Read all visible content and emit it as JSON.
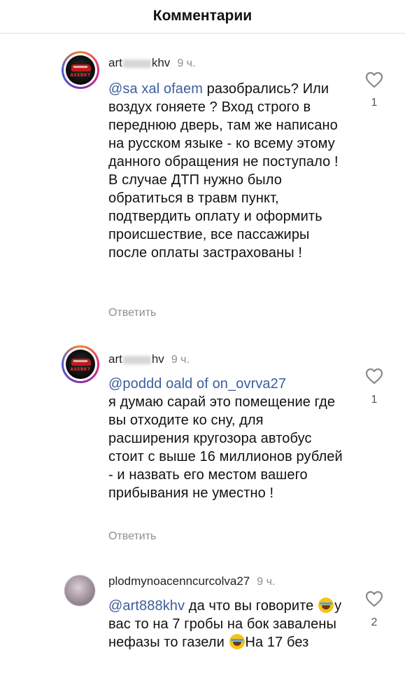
{
  "header": {
    "title": "Комментарии"
  },
  "comments": [
    {
      "username_start": "art",
      "username_end": "khv",
      "time": "9 ч.",
      "mention": "@sa  xal ofaem",
      "text": " разобрались? Или воздух гоняете ? Вход строго в переднюю дверь, там же написано на русском языке - ко всему этому данного обращения не поступало ! В случае ДТП нужно было обратиться в травм пункт, подтвердить оплату и оформить происшествие, все пассажиры после оплаты застрахованы !",
      "reply_label": "Ответить",
      "likes": "1"
    },
    {
      "username_start": "art",
      "username_end": "hv",
      "time": "9 ч.",
      "mention": "@poddd oald of on_ovrva27",
      "text": "я думаю сарай это помещение где вы отходите ко сну, для расширения кругозора автобус стоит с выше 16 миллионов рублей - и назвать его местом вашего прибывания не уместно !",
      "reply_label": "Ответить",
      "likes": "1"
    },
    {
      "username": "plodmynoacenncurcolva27",
      "time": "9 ч.",
      "mention": "@art888khv",
      "text_part1": " да что вы говорите ",
      "text_part2": "у вас то на 7 гробы на бок завалены нефазы то газели ",
      "text_part3": "На 17 без",
      "likes": "2"
    }
  ],
  "avatar_brand": "ASSBKT"
}
